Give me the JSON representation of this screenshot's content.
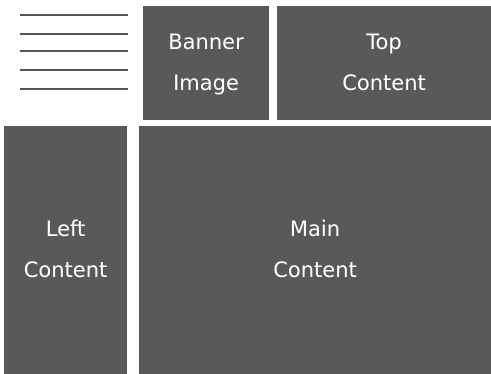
{
  "menu": {
    "icon": "hamburger-menu-icon",
    "line_count": 5
  },
  "blocks": {
    "banner": {
      "line1": "Banner",
      "line2": "Image"
    },
    "top": {
      "line1": "Top",
      "line2": "Content"
    },
    "left": {
      "line1": "Left",
      "line2": "Content"
    },
    "main": {
      "line1": "Main",
      "line2": "Content"
    }
  },
  "colors": {
    "block_fill": "#595959",
    "menu_lines": "#555555",
    "text": "#ffffff",
    "background": "#ffffff"
  }
}
